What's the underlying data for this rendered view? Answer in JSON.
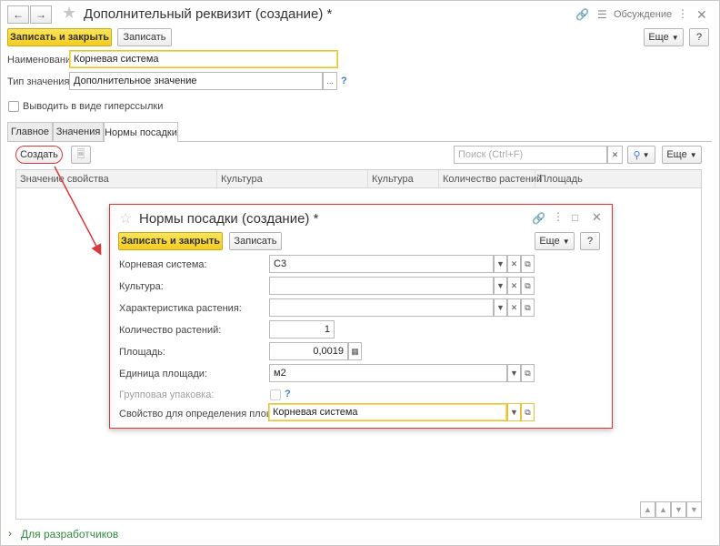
{
  "window": {
    "title": "Дополнительный реквизит (создание) *",
    "discussion_label": "Обсуждение"
  },
  "toolbar": {
    "save_close": "Записать и закрыть",
    "save": "Записать",
    "more": "Еще",
    "help": "?"
  },
  "form": {
    "name_label": "Наименование:",
    "name_value": "Корневая система",
    "type_label": "Тип значения:",
    "type_value": "Дополнительное значение",
    "type_select": "...",
    "hyperlink_label": "Выводить в виде гиперссылки"
  },
  "tabs": [
    {
      "label": "Главное"
    },
    {
      "label": "Значения"
    },
    {
      "label": "Нормы посадки"
    }
  ],
  "list_toolbar": {
    "create": "Создать",
    "search_placeholder": "Поиск (Ctrl+F)",
    "more": "Еще"
  },
  "table": {
    "columns": [
      "Значение свойства",
      "Культура",
      "Культура",
      "Количество растений",
      "Площадь"
    ]
  },
  "dialog": {
    "title": "Нормы посадки (создание) *",
    "save_close": "Записать и закрыть",
    "save": "Записать",
    "more": "Еще",
    "help": "?",
    "fields": {
      "root_label": "Корневая система:",
      "root_value": "С3",
      "culture_label": "Культура:",
      "culture_value": "",
      "characteristic_label": "Характеристика растения:",
      "characteristic_value": "",
      "count_label": "Количество растений:",
      "count_value": "1",
      "area_label": "Площадь:",
      "area_value": "0,0019",
      "unit_label": "Единица площади:",
      "unit_value": "м2",
      "group_label": "Групповая упаковка:",
      "property_label": "Свойство для определения площади:",
      "property_value": "Корневая система"
    }
  },
  "footer": {
    "developers": "Для разработчиков"
  },
  "colors": {
    "primary_button": "#f3cc1e",
    "highlight_red": "#d9393b",
    "link_green": "#2e8b3d",
    "link_blue": "#3b7ed6"
  }
}
